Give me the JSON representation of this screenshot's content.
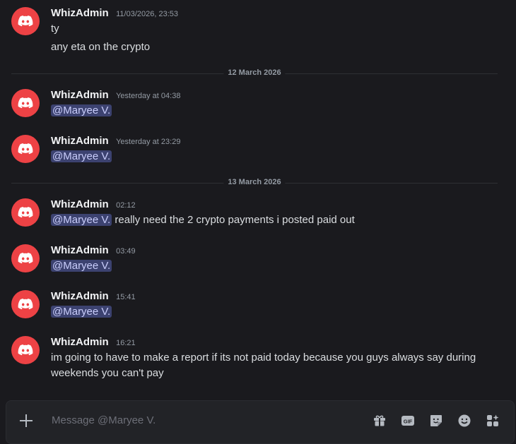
{
  "messages": [
    {
      "author": "WhizAdmin",
      "time": "11/03/2026, 23:53",
      "lines": [
        {
          "text": "ty"
        },
        {
          "text": "any eta on the crypto"
        }
      ]
    },
    {
      "author": "WhizAdmin",
      "time": "Yesterday at 04:38",
      "lines": [
        {
          "mention": "@Maryee V.",
          "text": ""
        }
      ]
    },
    {
      "author": "WhizAdmin",
      "time": "Yesterday at 23:29",
      "lines": [
        {
          "mention": "@Maryee V.",
          "text": ""
        }
      ]
    },
    {
      "author": "WhizAdmin",
      "time": "02:12",
      "lines": [
        {
          "mention": "@Maryee V.",
          "text": " really need the 2 crypto payments i posted paid out"
        }
      ]
    },
    {
      "author": "WhizAdmin",
      "time": "03:49",
      "lines": [
        {
          "mention": "@Maryee V.",
          "text": ""
        }
      ]
    },
    {
      "author": "WhizAdmin",
      "time": "15:41",
      "lines": [
        {
          "mention": "@Maryee V.",
          "text": ""
        }
      ]
    },
    {
      "author": "WhizAdmin",
      "time": "16:21",
      "lines": [
        {
          "text": "im going to have to make a report if its not paid today because you guys always say during"
        },
        {
          "text": "weekends you can't pay"
        }
      ]
    }
  ],
  "dividers": [
    "12 March 2026",
    "13 March 2026"
  ],
  "composer": {
    "placeholder": "Message @Maryee V.",
    "tools": [
      {
        "icon": "gift-icon"
      },
      {
        "icon": "gif-icon",
        "label": "GIF"
      },
      {
        "icon": "sticker-icon"
      },
      {
        "icon": "emoji-icon"
      },
      {
        "icon": "apps-icon"
      }
    ]
  },
  "colors": {
    "avatar": "#ed4245",
    "mention_bg": "#3c4270",
    "mention_text": "#c9cdfb",
    "background": "#1a1a1e"
  }
}
